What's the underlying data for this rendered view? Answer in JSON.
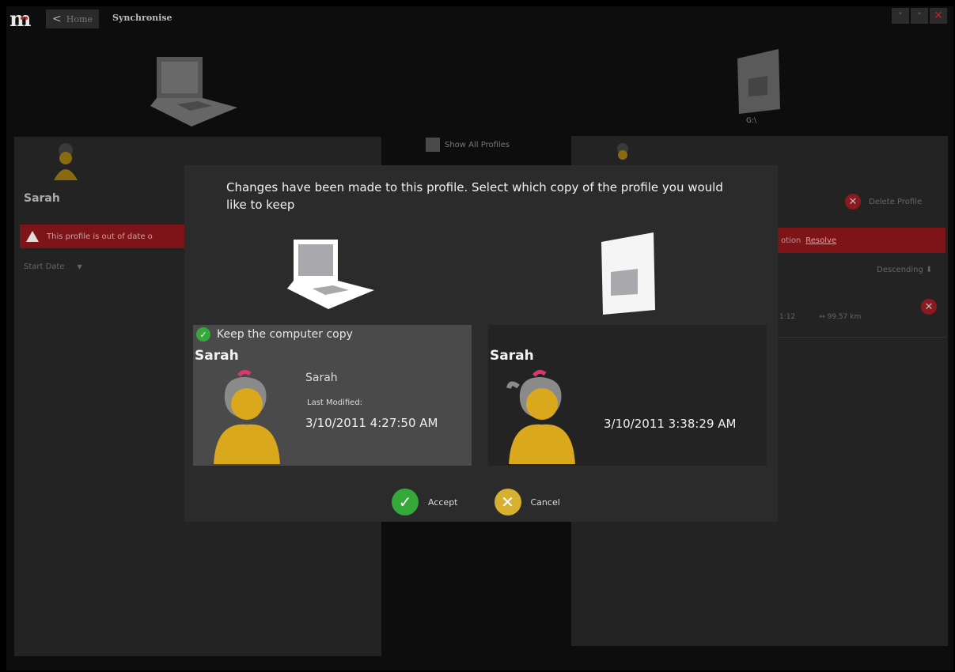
{
  "window": {
    "logo": "m",
    "nav_home": "Home",
    "breadcrumb": "Synchronise",
    "controls": [
      "˅",
      "˄",
      "✕"
    ]
  },
  "background": {
    "drive_label": "G:\\",
    "show_all_profiles": "Show All Profiles",
    "left_profile_name": "Sarah",
    "out_of_date_warning": "This profile is out of date o",
    "sort_field": "Start Date",
    "delete_profile": "Delete Profile",
    "right_bar_text": "otion",
    "right_bar_link": "Resolve",
    "sort_order": "Descending ⬇",
    "activity_time": "1:12",
    "activity_distance": "↔ 99.57 km"
  },
  "modal": {
    "title": "Changes have been made to this profile. Select which copy of the profile you would like to keep",
    "left_card": {
      "keep_label": "Keep the computer copy",
      "name": "Sarah",
      "subtitle": "Sarah",
      "last_modified_label": "Last Modified:",
      "date": "3/10/2011 4:27:50 AM",
      "selected": true
    },
    "right_card": {
      "name": "Sarah",
      "date": "3/10/2011 3:38:29 AM",
      "selected": false
    },
    "accept_label": "Accept",
    "cancel_label": "Cancel"
  },
  "colors": {
    "accent_red": "#c0202a",
    "accent_green": "#35a83a",
    "accent_yellow": "#d8b030",
    "avatar_body": "#d9a81c",
    "avatar_hair": "#8a8a8a"
  }
}
